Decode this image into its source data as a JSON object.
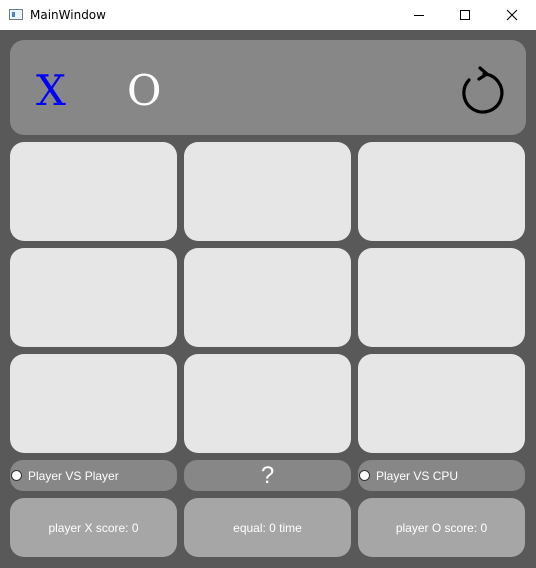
{
  "window": {
    "title": "MainWindow",
    "controls": [
      "minimize-icon",
      "maximize-icon",
      "close-icon"
    ]
  },
  "header": {
    "player_x_symbol": "X",
    "player_o_symbol": "O",
    "restart_icon": "restart-icon",
    "colors": {
      "x": "#0000ff",
      "o": "#ffffff"
    }
  },
  "board": {
    "cells": [
      "",
      "",
      "",
      "",
      "",
      "",
      "",
      "",
      ""
    ]
  },
  "modes": {
    "pvp_label": "Player VS Player",
    "help_label": "?",
    "cpu_label": "Player VS CPU"
  },
  "scores": {
    "player_x": "player X score: 0",
    "equal": "equal: 0 time",
    "player_o": "player O score: 0"
  }
}
